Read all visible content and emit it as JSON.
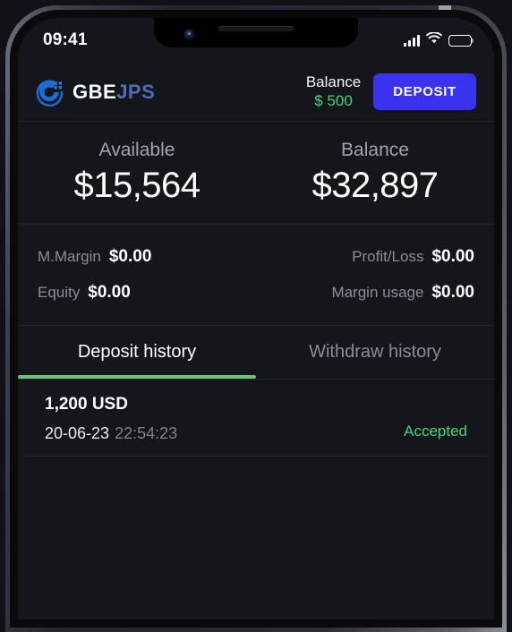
{
  "status_bar": {
    "time": "09:41",
    "signal_icon": "cellular-signal-icon",
    "wifi_icon": "wifi-icon",
    "battery_icon": "battery-full-icon"
  },
  "header": {
    "brand_primary": "GBE",
    "brand_secondary": "JPS",
    "brand_mark_icon": "gbejps-logo-icon",
    "balance_label": "Balance",
    "balance_value": "$ 500",
    "deposit_label": "DEPOSIT",
    "accent_color": "#3b32f0",
    "positive_color": "#3dd87a"
  },
  "balances": [
    {
      "label": "Available",
      "value": "$15,564"
    },
    {
      "label": "Balance",
      "value": "$32,897"
    }
  ],
  "metrics": {
    "left": [
      {
        "label": "M.Margin",
        "value": "$0.00"
      },
      {
        "label": "Equity",
        "value": "$0.00"
      }
    ],
    "right": [
      {
        "label": "Profit/Loss",
        "value": "$0.00"
      },
      {
        "label": "Margin usage",
        "value": "$0.00"
      }
    ]
  },
  "tabs": [
    {
      "label": "Deposit history",
      "active": true
    },
    {
      "label": "Withdraw history",
      "active": false
    }
  ],
  "tab_indicator_color": "#6fc07a",
  "history": [
    {
      "amount": "1,200 USD",
      "date": "20-06-23",
      "time": "22:54:23",
      "status": "Accepted",
      "status_color": "#3dd87a"
    }
  ]
}
